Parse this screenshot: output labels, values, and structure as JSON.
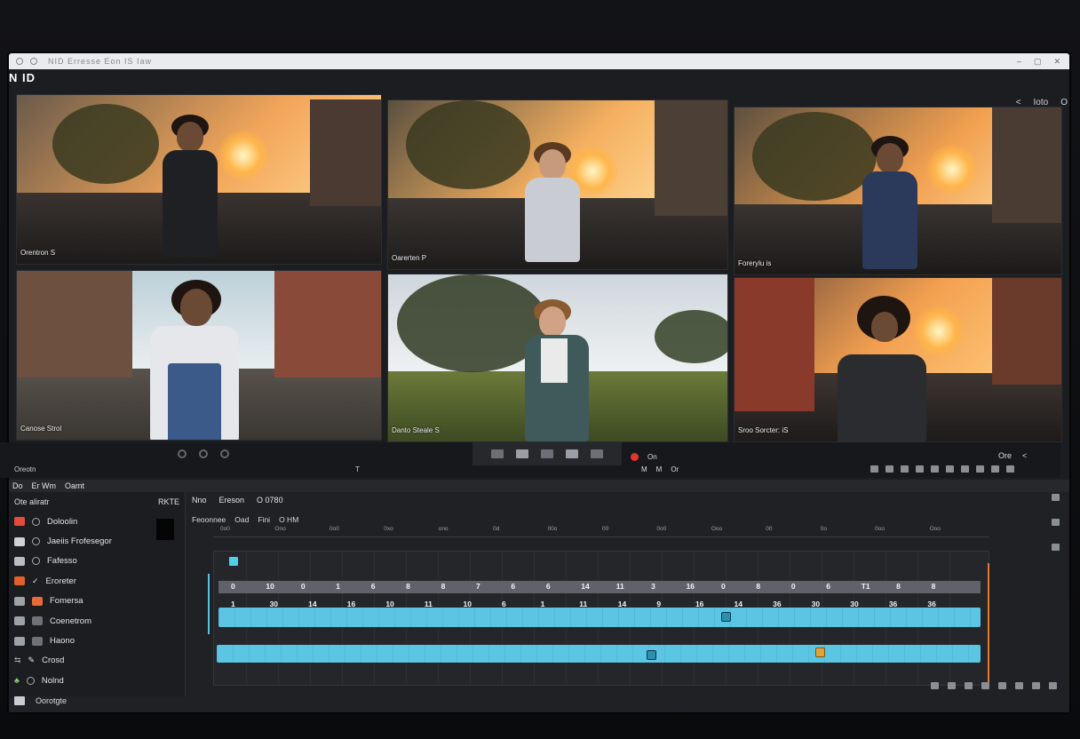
{
  "app": {
    "name": "N ID",
    "titlebar_text": "NID  Erresse Eon IS Iaw",
    "window_controls": [
      "min-icon",
      "max-icon",
      "close-icon"
    ]
  },
  "top_right": {
    "back": "<",
    "label": "Ioto",
    "circle": "O"
  },
  "preview_tiles": [
    {
      "caption": "Orentron S",
      "scene": "street-sunset"
    },
    {
      "caption": "Oarerten P",
      "scene": "street-sunset"
    },
    {
      "caption": "Forerylu is",
      "scene": "street-sunset"
    },
    {
      "caption": "Canose Strol",
      "scene": "street-day"
    },
    {
      "caption": "Danto Steale S",
      "scene": "field"
    },
    {
      "caption": "Sroo Sorcter: iS",
      "scene": "street-sunset"
    }
  ],
  "preview_controls": {
    "left_label": "Oreotn",
    "left_small": "T",
    "rec_labels": [
      "On",
      "M",
      "M",
      "Or"
    ],
    "right_label": "Ore",
    "right_back": "<"
  },
  "menu": [
    "Do",
    "Er Wm",
    "Oamt"
  ],
  "sidebar": {
    "title": "Ote  aliratr",
    "badge": "RKTE",
    "items": [
      {
        "label": "Doloolin",
        "color": "#e44b3a"
      },
      {
        "label": "Jaeiis Frofesegor",
        "color": "#cfd3d8"
      },
      {
        "label": "Fafesso",
        "color": "#b9bcc2"
      },
      {
        "label": "Eroreter",
        "color": "#e0612b"
      },
      {
        "label": "Fomersa",
        "color": "#e86a3a"
      },
      {
        "label": "Coenetrom",
        "color": "#9ea3aa"
      },
      {
        "label": "Haono",
        "color": "#9ea3aa"
      },
      {
        "label": "Crosd",
        "color": "#9ea3aa"
      },
      {
        "label": "Nolnd",
        "color": "#8bd07a"
      }
    ],
    "footer": "Oorotgte"
  },
  "timeline": {
    "header": [
      "Nno",
      "Ereson",
      "O 0780"
    ],
    "sub": [
      "Feoonnee",
      "Oad",
      "Fini",
      "O HM"
    ],
    "ruler_labels": [
      "0o0",
      "Ono",
      "0o0",
      "0xo",
      "ono",
      "0d",
      "00o",
      "00",
      "0o0",
      "Ooo",
      "00",
      "0o",
      "0oo",
      "Ooo"
    ],
    "row1": [
      "0",
      "10",
      "0",
      "1",
      "6",
      "8",
      "8",
      "7",
      "6",
      "6",
      "14",
      "11",
      "3",
      "16",
      "0",
      "8",
      "0",
      "6",
      "T1",
      "8",
      "8"
    ],
    "row2": [
      "1",
      "30",
      "14",
      "16",
      "10",
      "11",
      "10",
      "6",
      "1",
      "11",
      "14",
      "9",
      "16",
      "14",
      "36",
      "30",
      "30",
      "36",
      "36"
    ],
    "clip_markers": [
      "blue",
      "blue",
      "orange"
    ],
    "accent": "#5bc6e3",
    "playhead_color": "#e07a2e"
  }
}
